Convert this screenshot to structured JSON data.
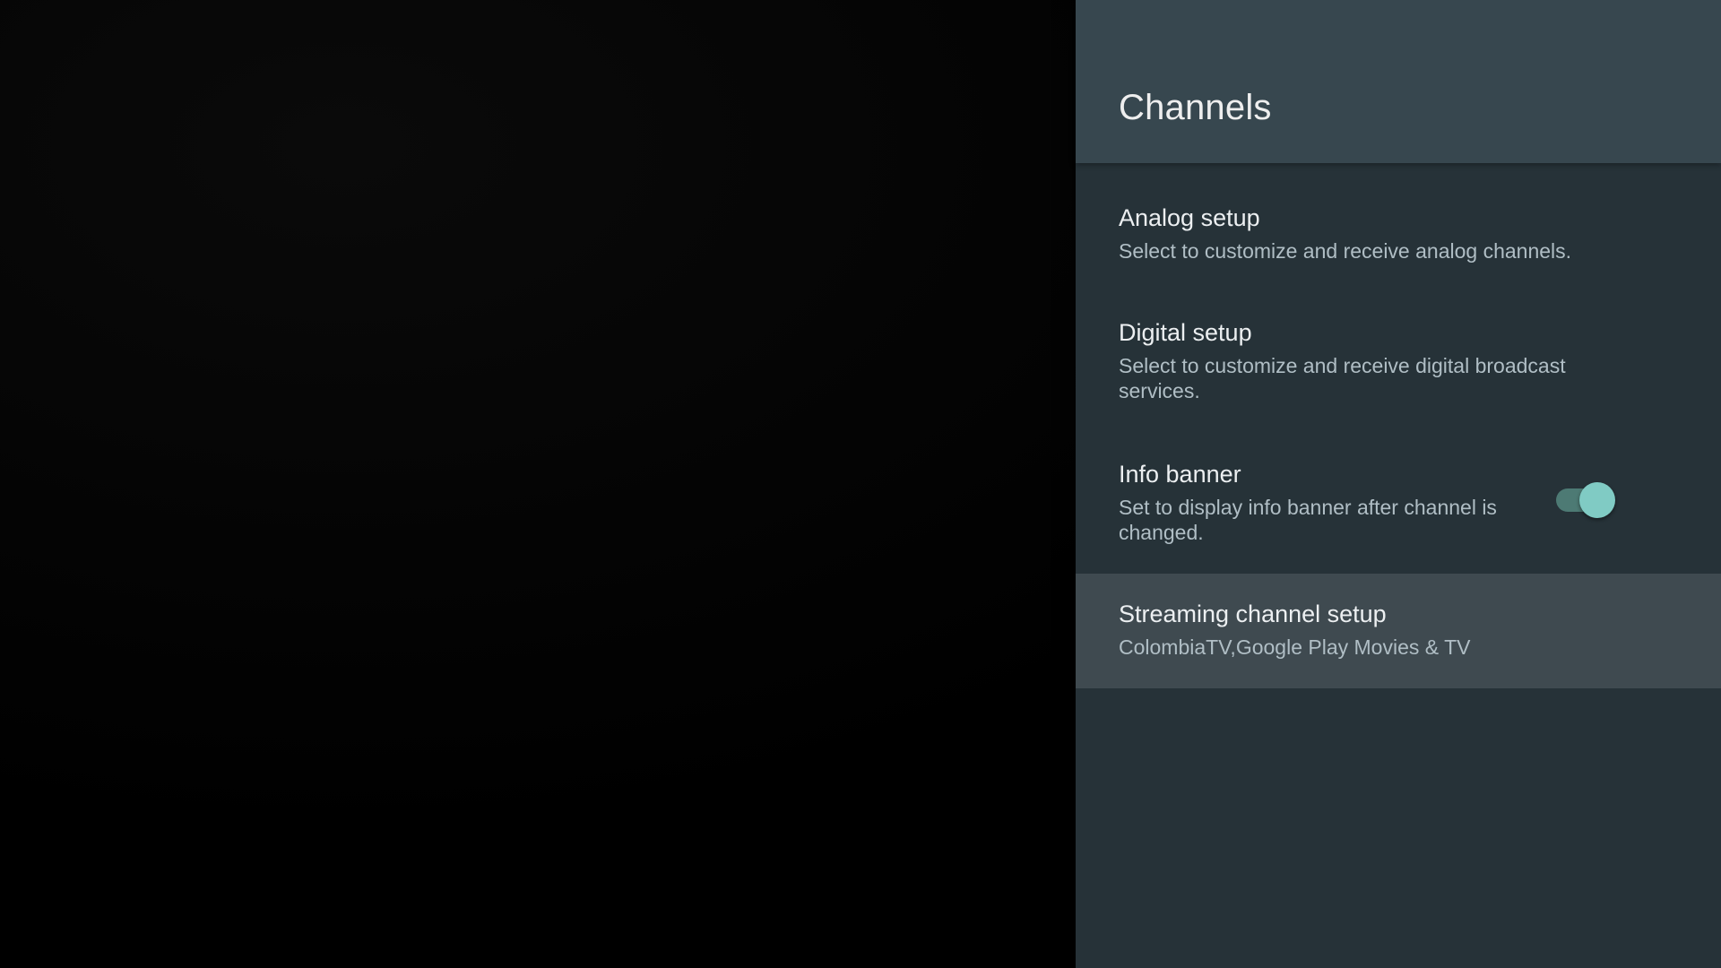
{
  "header": {
    "title": "Channels"
  },
  "items": [
    {
      "title": "Analog setup",
      "summary": "Select to customize and receive analog channels."
    },
    {
      "title": "Digital setup",
      "summary": "Select to customize and receive digital broadcast services."
    },
    {
      "title": "Info banner",
      "summary": "Set to display info banner after channel is changed.",
      "toggle_on": true
    },
    {
      "title": "Streaming channel setup",
      "summary": "ColombiaTV,Google Play Movies & TV",
      "focused": true
    }
  ],
  "colors": {
    "panel_background": "#263238",
    "header_background": "#37474f",
    "focused_row": "#3f4a50",
    "toggle_accent": "#80cbc4"
  }
}
